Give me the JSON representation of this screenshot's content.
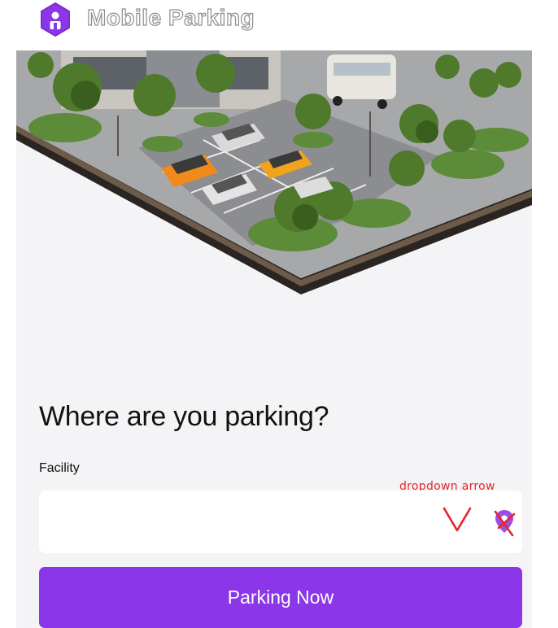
{
  "app": {
    "title": "Mobile Parking",
    "logo_icon": "app-logo-icon",
    "brand_color": "#8b36e8"
  },
  "hero": {
    "alt": "parking-lot-illustration"
  },
  "form": {
    "heading": "Where are you parking?",
    "facility_label": "Facility",
    "facility_value": "",
    "dropdown_icon": "chevron-down-icon",
    "location_icon": "map-pin-icon",
    "annotation": "dropdown arrow",
    "annotation_color": "#e5262c"
  },
  "actions": {
    "primary_label": "Parking Now"
  }
}
